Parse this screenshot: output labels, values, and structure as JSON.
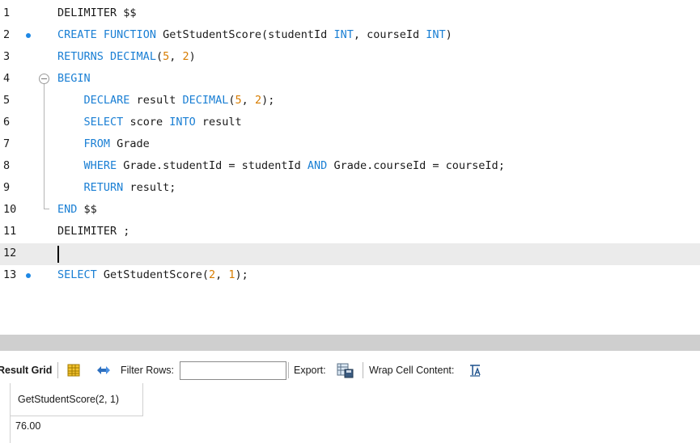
{
  "editor": {
    "lines": [
      {
        "num": "1",
        "text": "DELIMITER $$"
      },
      {
        "num": "2",
        "text": "CREATE FUNCTION GetStudentScore(studentId INT, courseId INT)"
      },
      {
        "num": "3",
        "text": "RETURNS DECIMAL(5, 2)"
      },
      {
        "num": "4",
        "text": "BEGIN"
      },
      {
        "num": "5",
        "text": "    DECLARE result DECIMAL(5, 2);"
      },
      {
        "num": "6",
        "text": "    SELECT score INTO result"
      },
      {
        "num": "7",
        "text": "    FROM Grade"
      },
      {
        "num": "8",
        "text": "    WHERE Grade.studentId = studentId AND Grade.courseId = courseId;"
      },
      {
        "num": "9",
        "text": "    RETURN result;"
      },
      {
        "num": "10",
        "text": "END $$"
      },
      {
        "num": "11",
        "text": "DELIMITER ;"
      },
      {
        "num": "12",
        "text": ""
      },
      {
        "num": "13",
        "text": "SELECT GetStudentScore(2, 1);"
      }
    ],
    "statement_marker_color": "#1e88e5",
    "keyword_color": "#1a7fd4",
    "number_color": "#d77c00"
  },
  "toolbar": {
    "result_grid_label": "Result Grid",
    "filter_rows_label": "Filter Rows:",
    "filter_rows_value": "",
    "export_label": "Export:",
    "wrap_label": "Wrap Cell Content:"
  },
  "grid": {
    "columns": [
      "GetStudentScore(2, 1)"
    ],
    "rows": [
      [
        "76.00"
      ]
    ]
  }
}
